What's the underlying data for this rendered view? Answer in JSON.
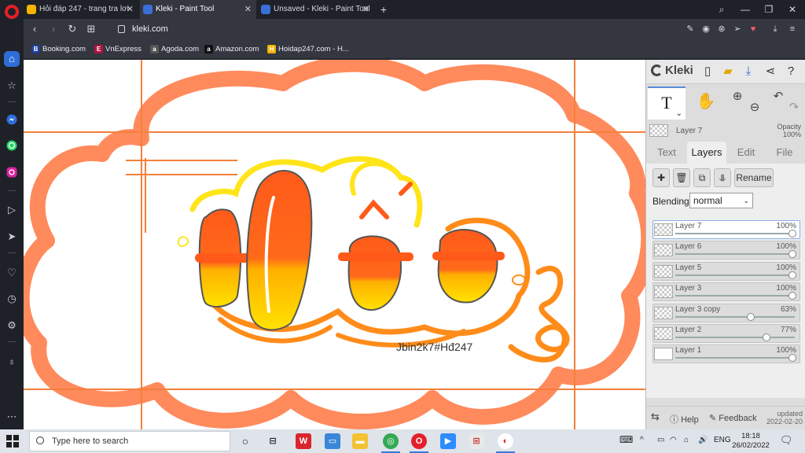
{
  "browser": {
    "tabs": [
      {
        "title": "Hỏi đáp 247 - trang tra lơi",
        "favicon_color": "#f5b400"
      },
      {
        "title": "Kleki - Paint Tool",
        "favicon_color": "#3a6fd8"
      },
      {
        "title": "Unsaved - Kleki - Paint Tool",
        "favicon_color": "#3a6fd8"
      }
    ],
    "url": "kleki.com",
    "bookmarks": [
      {
        "label": "Booking.com",
        "icon": "B",
        "color": "#1c3f95"
      },
      {
        "label": "VnExpress",
        "icon": "E",
        "color": "#b1133f"
      },
      {
        "label": "Agoda.com",
        "icon": "a",
        "color": "#555"
      },
      {
        "label": "Amazon.com",
        "icon": "a",
        "color": "#111"
      },
      {
        "label": "Hoidap247.com - H...",
        "icon": "H",
        "color": "#f5b400"
      }
    ]
  },
  "canvas": {
    "signature": "Jbin2k7#Hđ247"
  },
  "kleki": {
    "logo": "Kleki",
    "current_layer": "Layer 7",
    "opacity_label": "Opacity",
    "opacity_value": "100%",
    "tabs": [
      "Text",
      "Layers",
      "Edit",
      "File"
    ],
    "active_tab": "Layers",
    "rename_label": "Rename",
    "blending_label": "Blending",
    "blending_value": "normal",
    "layers": [
      {
        "name": "Layer 7",
        "opacity": "100%",
        "opacity_fraction": 1.0,
        "active": true
      },
      {
        "name": "Layer 6",
        "opacity": "100%",
        "opacity_fraction": 1.0,
        "active": false
      },
      {
        "name": "Layer 5",
        "opacity": "100%",
        "opacity_fraction": 1.0,
        "active": false
      },
      {
        "name": "Layer 3",
        "opacity": "100%",
        "opacity_fraction": 1.0,
        "active": false
      },
      {
        "name": "Layer 3 copy",
        "opacity": "63%",
        "opacity_fraction": 0.63,
        "active": false
      },
      {
        "name": "Layer 2",
        "opacity": "77%",
        "opacity_fraction": 0.77,
        "active": false
      },
      {
        "name": "Layer 1",
        "opacity": "100%",
        "opacity_fraction": 1.0,
        "active": false
      }
    ],
    "help_label": "Help",
    "feedback_label": "Feedback",
    "updated_label": "updated",
    "updated_date": "2022-02-20"
  },
  "taskbar": {
    "search_placeholder": "Type here to search",
    "lang": "ENG",
    "time": "18:18",
    "date": "26/02/2022"
  }
}
